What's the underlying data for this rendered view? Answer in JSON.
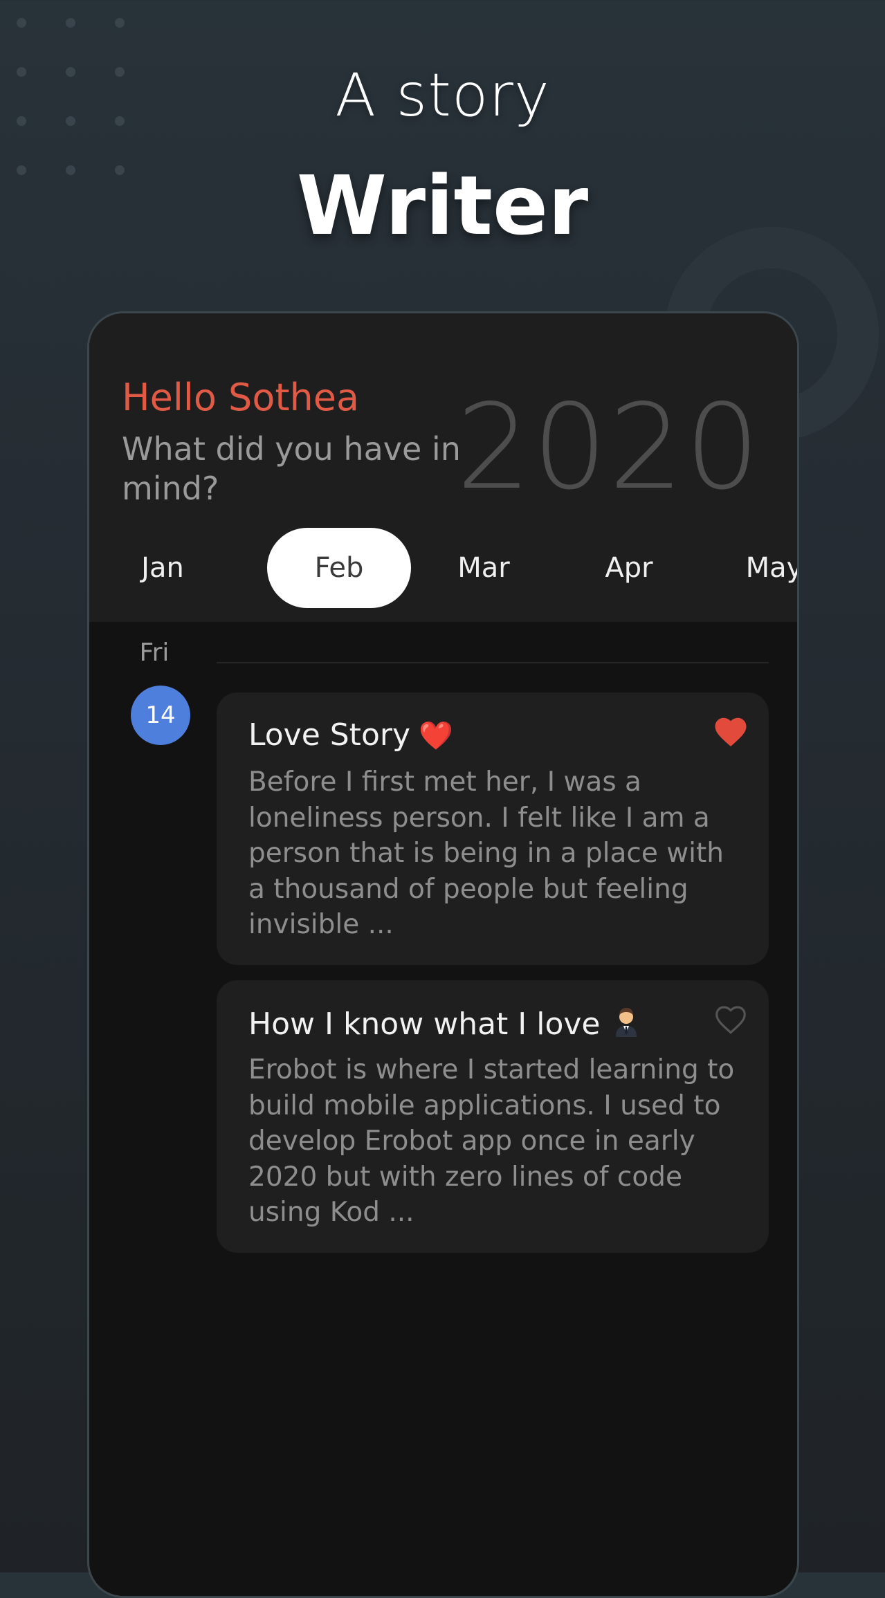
{
  "headline": {
    "line1": "A story",
    "line2": "Writer"
  },
  "header": {
    "greeting": "Hello Sothea",
    "prompt": "What did you have in mind?",
    "year": "2020"
  },
  "months": [
    {
      "label": "Jan",
      "active": false
    },
    {
      "label": "Feb",
      "active": true
    },
    {
      "label": "Mar",
      "active": false
    },
    {
      "label": "Apr",
      "active": false
    },
    {
      "label": "May",
      "active": false
    }
  ],
  "timeline": {
    "day_name": "Fri",
    "day_number": "14"
  },
  "stories": [
    {
      "title": "Love Story",
      "title_emoji": "❤️",
      "body": "Before I first met her, I was a loneliness person. I felt like I am a person that is being in a place with a thousand of people but feeling invisible  ...",
      "favorite": true,
      "favorite_icon": "heart-filled-icon"
    },
    {
      "title": "How I know what I love",
      "title_emoji": "man-in-suit-emoji",
      "body": "Erobot is where I started learning to build mobile applications. I used to develop Erobot app once in early 2020 but with zero lines of code using Kod ...",
      "favorite": false,
      "favorite_icon": "heart-outline-icon"
    }
  ],
  "colors": {
    "accent_red": "#e05a45",
    "day_badge_blue": "#4f7fdc",
    "card_background": "#1f1f1f",
    "screen_background": "#121212"
  }
}
